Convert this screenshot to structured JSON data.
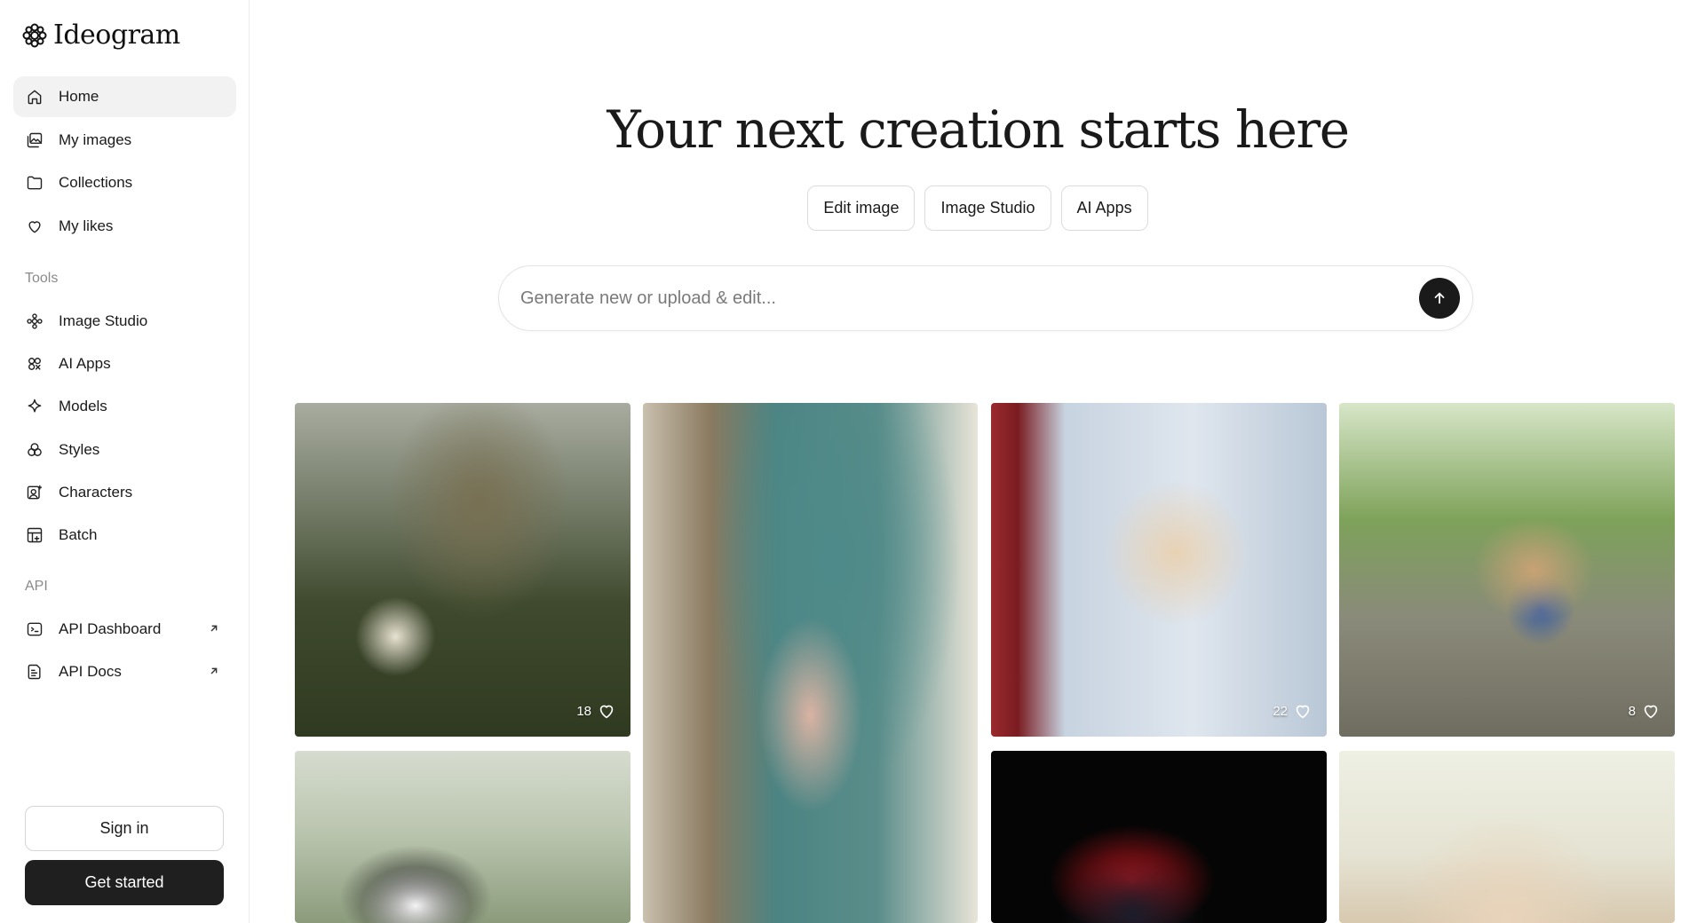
{
  "app": {
    "name": "Ideogram"
  },
  "sidebar": {
    "nav": [
      {
        "label": "Home",
        "icon": "home-icon",
        "active": true
      },
      {
        "label": "My images",
        "icon": "images-icon"
      },
      {
        "label": "Collections",
        "icon": "folder-icon"
      },
      {
        "label": "My likes",
        "icon": "heart-icon"
      }
    ],
    "tools_label": "Tools",
    "tools": [
      {
        "label": "Image Studio",
        "icon": "studio-icon"
      },
      {
        "label": "AI Apps",
        "icon": "apps-icon"
      },
      {
        "label": "Models",
        "icon": "sparkle-icon"
      },
      {
        "label": "Styles",
        "icon": "styles-icon"
      },
      {
        "label": "Characters",
        "icon": "character-icon"
      },
      {
        "label": "Batch",
        "icon": "batch-icon"
      }
    ],
    "api_label": "API",
    "api": [
      {
        "label": "API Dashboard",
        "icon": "terminal-icon",
        "external": true
      },
      {
        "label": "API Docs",
        "icon": "docs-icon",
        "external": true
      }
    ],
    "signin_label": "Sign in",
    "getstarted_label": "Get started"
  },
  "main": {
    "title": "Your next creation starts here",
    "chips": [
      "Edit image",
      "Image Studio",
      "AI Apps"
    ],
    "prompt_placeholder": "Generate new or upload & edit..."
  },
  "gallery": [
    {
      "subject": "boy lying in forest with egrets",
      "likes": "18"
    },
    {
      "subject": "woman sitting by teal door holding cup",
      "likes": null
    },
    {
      "subject": "cat with crown on balcony",
      "likes": "22"
    },
    {
      "subject": "pug carrying newspaper in park",
      "likes": "8"
    },
    {
      "subject": "panda in bamboo forest",
      "likes": null
    },
    {
      "subject": "dark creature with red flames",
      "likes": null
    },
    {
      "subject": "anime girl with hair clip",
      "likes": null
    }
  ]
}
